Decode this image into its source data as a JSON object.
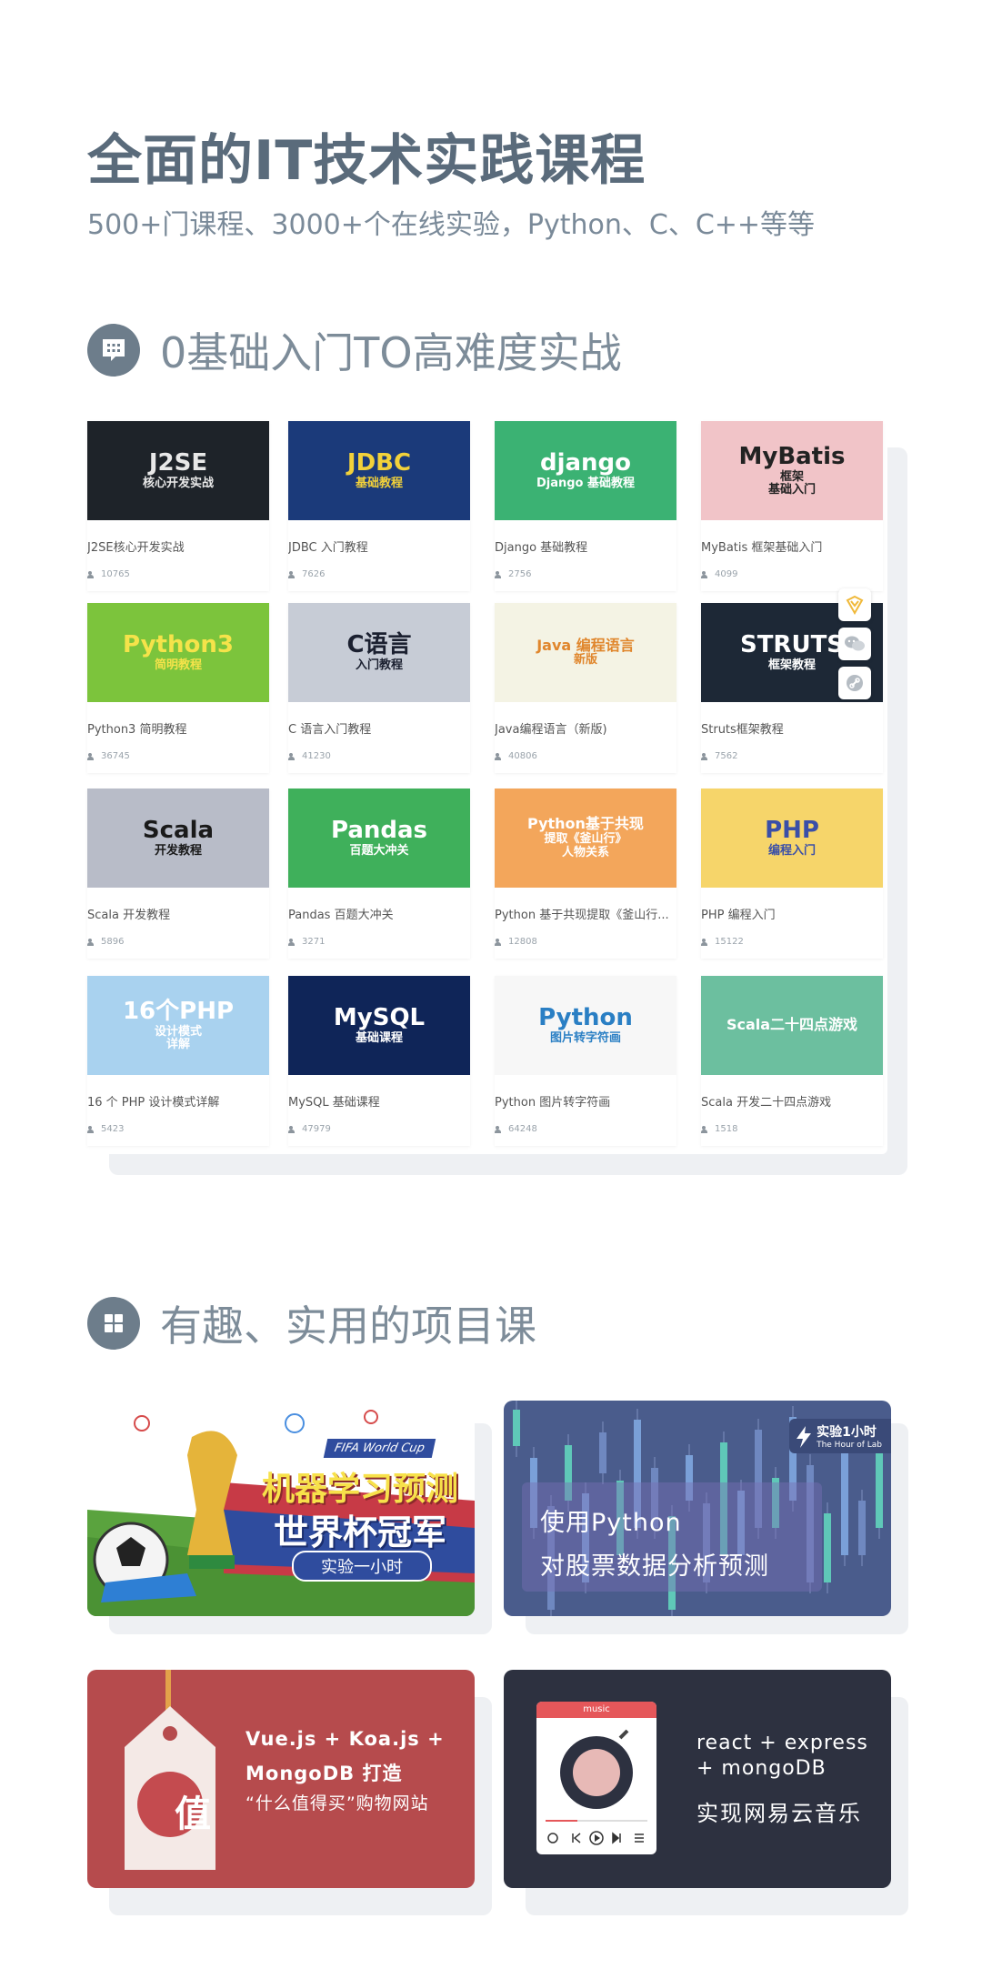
{
  "header": {
    "title": "全面的IT技术实践课程",
    "subtitle": "500+门课程、3000+个在线实验，Python、C、C++等等"
  },
  "section1": {
    "title": "0基础入门TO高难度实战",
    "icon": "chat-grid-icon"
  },
  "courses": [
    {
      "name": "J2SE核心开发实战",
      "count": "10765",
      "thumb_lines": [
        "J2SE",
        "核心开发实战"
      ],
      "thumb_bg": "#1e2329",
      "thumb_color": "#e8e8e8"
    },
    {
      "name": "JDBC 入门教程",
      "count": "7626",
      "thumb_lines": [
        "JDBC",
        "基础教程"
      ],
      "thumb_bg": "#1b3a7a",
      "thumb_color": "#f2d13a"
    },
    {
      "name": "Django 基础教程",
      "count": "2756",
      "thumb_lines": [
        "django",
        "Django 基础教程"
      ],
      "thumb_bg": "#3bb273",
      "thumb_color": "#ffffff"
    },
    {
      "name": "MyBatis 框架基础入门",
      "count": "4099",
      "thumb_lines": [
        "MyBatis",
        "框架",
        "基础入门"
      ],
      "thumb_bg": "#f1c4c8",
      "thumb_color": "#222222"
    },
    {
      "name": "Python3 简明教程",
      "count": "36745",
      "thumb_lines": [
        "Python3",
        "简明教程"
      ],
      "thumb_bg": "#7cc43c",
      "thumb_color": "#f5e34a"
    },
    {
      "name": "C 语言入门教程",
      "count": "41230",
      "thumb_lines": [
        "C语言",
        "入门教程"
      ],
      "thumb_bg": "#c7ccd6",
      "thumb_color": "#1b2030"
    },
    {
      "name": "Java编程语言（新版)",
      "count": "40806",
      "thumb_lines": [
        "Java 编程语言",
        "新版"
      ],
      "thumb_bg": "#f4f3e4",
      "thumb_color": "#e0862c"
    },
    {
      "name": "Struts框架教程",
      "count": "7562",
      "thumb_lines": [
        "STRUTS",
        "框架教程"
      ],
      "thumb_bg": "#1d2836",
      "thumb_color": "#ffffff"
    },
    {
      "name": "Scala 开发教程",
      "count": "5896",
      "thumb_lines": [
        "Scala",
        "开发教程"
      ],
      "thumb_bg": "#b8bcc8",
      "thumb_color": "#1a1a1a"
    },
    {
      "name": "Pandas 百题大冲关",
      "count": "3271",
      "thumb_lines": [
        "Pandas",
        "百题大冲关"
      ],
      "thumb_bg": "#3fb05b",
      "thumb_color": "#ffffff"
    },
    {
      "name": "Python 基于共现提取《釜山行...",
      "count": "12808",
      "thumb_lines": [
        "Python基于共现",
        "提取《釜山行》",
        "人物关系"
      ],
      "thumb_bg": "#f3a65b",
      "thumb_color": "#ffffff"
    },
    {
      "name": "PHP 编程入门",
      "count": "15122",
      "thumb_lines": [
        "PHP",
        "编程入门"
      ],
      "thumb_bg": "#f6d56a",
      "thumb_color": "#3a4fa8"
    },
    {
      "name": "16 个 PHP 设计模式详解",
      "count": "5423",
      "thumb_lines": [
        "16个PHP",
        "设计模式",
        "详解"
      ],
      "thumb_bg": "#a9d2ef",
      "thumb_color": "#ffffff"
    },
    {
      "name": "MySQL 基础课程",
      "count": "47979",
      "thumb_lines": [
        "MySQL",
        "基础课程"
      ],
      "thumb_bg": "#0f2558",
      "thumb_color": "#ffffff"
    },
    {
      "name": "Python 图片转字符画",
      "count": "64248",
      "thumb_lines": [
        "Python",
        "图片转字符画"
      ],
      "thumb_bg": "#f7f7f7",
      "thumb_color": "#2a7fc4"
    },
    {
      "name": "Scala 开发二十四点游戏",
      "count": "1518",
      "thumb_lines": [
        "Scala二十四点游戏"
      ],
      "thumb_bg": "#6cbf9f",
      "thumb_color": "#ffffff"
    }
  ],
  "side_buttons": [
    "badge-icon",
    "wechat-icon",
    "link-icon"
  ],
  "section2": {
    "title": "有趣、实用的项目课",
    "icon": "grid-icon"
  },
  "projects": [
    {
      "tag": "FIFA World Cup",
      "line1": "机器学习预测",
      "line2": "世界杯冠军",
      "pill": "实验一小时"
    },
    {
      "badge_line1": "实验1小时",
      "badge_line2": "The Hour of Lab",
      "line1": "使用Python",
      "line2": "对股票数据分析预测"
    },
    {
      "price_tag": "值",
      "line1": "Vue.js + Koa.js +",
      "line2": "MongoDB 打造",
      "line3": "“什么值得买”购物网站"
    },
    {
      "app_label": "music",
      "line1": "react + express",
      "line2": "+ mongoDB",
      "line3": "实现网易云音乐"
    }
  ]
}
